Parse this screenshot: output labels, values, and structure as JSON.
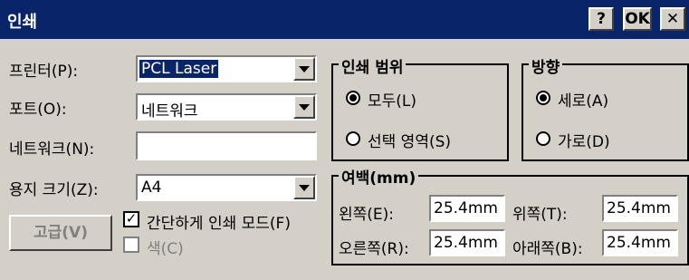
{
  "window": {
    "title": "인쇄",
    "help_label": "?",
    "ok_label": "OK",
    "close_label": "✕"
  },
  "left": {
    "printer_label": "프린터(P):",
    "printer_value": "PCL Laser",
    "port_label": "포트(O):",
    "port_value": "네트워크",
    "network_label": "네트워크(N):",
    "network_value": "",
    "paper_label": "용지 크기(Z):",
    "paper_value": "A4",
    "advanced_label": "고급(V)",
    "draft_label": "간단하게 인쇄 모드(F)",
    "color_label": "색(C)"
  },
  "range": {
    "title": "인쇄 범위",
    "all_label": "모두(L)",
    "selection_label": "선택 영역(S)"
  },
  "orientation": {
    "title": "방향",
    "portrait_label": "세로(A)",
    "landscape_label": "가로(D)"
  },
  "margins": {
    "title": "여백(mm)",
    "left_label": "왼쪽(E):",
    "left_value": "25.4mm",
    "top_label": "위쪽(T):",
    "top_value": "25.4mm",
    "right_label": "오른쪽(R):",
    "right_value": "25.4mm",
    "bottom_label": "아래쪽(B):",
    "bottom_value": "25.4mm"
  }
}
